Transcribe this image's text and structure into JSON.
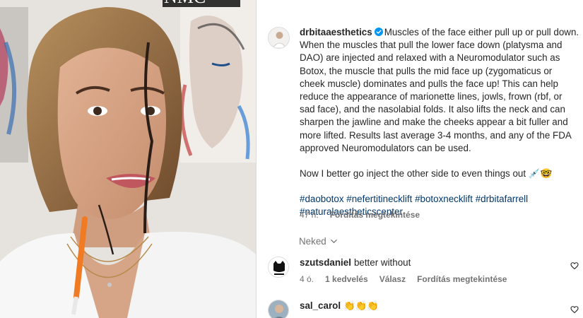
{
  "media": {
    "watermark": "NMC"
  },
  "post": {
    "username": "drbitaaesthetics",
    "caption_paragraph_1": "Muscles of the face either pull up or pull down. When the muscles that pull the lower face down (platysma and DAO) are injected and relaxed with a Neuromodulator such as Botox, the muscle that pulls the mid face up (zygomaticus or cheek muscle) dominates and pulls the face up! This can help reduce the appearance of marionette lines, jowls, frown (rbf, or sad face), and the nasolabial folds. It also lifts the neck and can sharpen the jawline and make the cheeks appear a bit fuller and more lifted. Results last average 3-4 months, and any of the FDA approved Neuromodulators can be used.",
    "caption_paragraph_2": "Now I better go inject the other side to even things out 💉🤓",
    "hashtags": [
      "#daobotox",
      "#nefertitinecklift",
      "#botoxnecklift",
      "#drbitafarrell",
      "#naturalaestheticscenter"
    ],
    "time": "47 h.",
    "translate_label": "Fordítás megtekintése"
  },
  "neked": {
    "label": "Neked"
  },
  "comments": [
    {
      "username": "szutsdaniel",
      "text": "better without",
      "time": "4 ó.",
      "likes": "1 kedvelés",
      "reply": "Válasz",
      "translate": "Fordítás megtekintése"
    },
    {
      "username": "sal_carol",
      "text": "👏👏👏"
    }
  ],
  "colors": {
    "verified": "#0095f6",
    "hashtag": "#00376b",
    "secondary_text": "#737373"
  },
  "icons": {
    "verified": "verified-badge-icon",
    "like": "heart-outline-icon",
    "chevron": "chevron-down-icon"
  }
}
